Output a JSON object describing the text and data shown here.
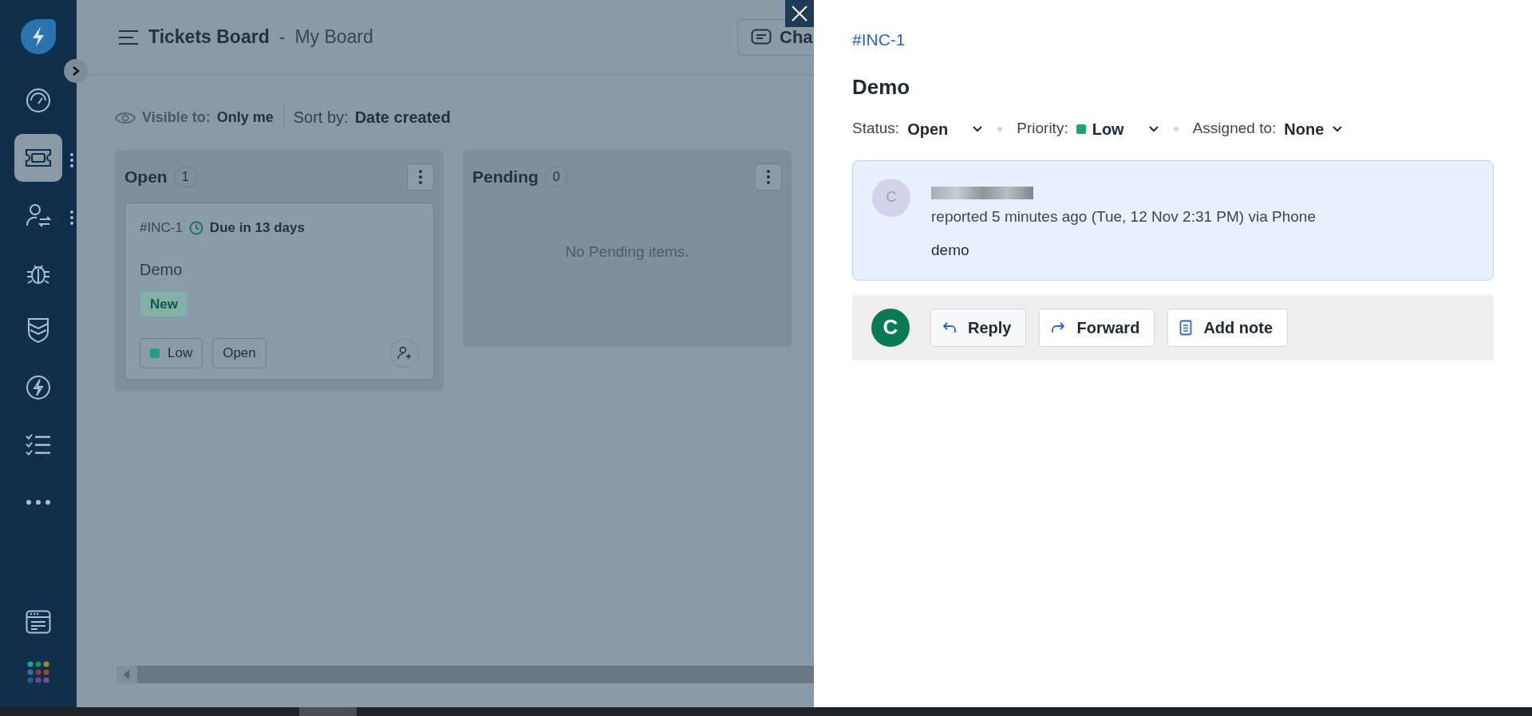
{
  "sidebar": {
    "items": [
      {
        "selected": false,
        "menu": false
      },
      {
        "selected": true,
        "menu": true
      },
      {
        "selected": false,
        "menu": true
      },
      {
        "selected": false,
        "menu": false
      },
      {
        "selected": false,
        "menu": false
      },
      {
        "selected": false,
        "menu": false
      },
      {
        "selected": false,
        "menu": false
      },
      {
        "selected": false,
        "menu": false
      }
    ]
  },
  "header": {
    "title": "Tickets Board",
    "separator": "-",
    "subtitle": "My Board",
    "chat_button": "Cha"
  },
  "filters": {
    "visible_label": "Visible to:",
    "visible_value": "Only me",
    "sort_label": "Sort by:",
    "sort_value": "Date created"
  },
  "columns": [
    {
      "title": "Open",
      "count": "1",
      "cards": [
        {
          "id": "#INC-1",
          "due": "Due in 13 days",
          "title": "Demo",
          "tag": "New",
          "priority": "Low",
          "color": "#1aa37a",
          "status": "Open"
        }
      ]
    },
    {
      "title": "Pending",
      "count": "0",
      "empty": "No Pending items."
    }
  ],
  "detail": {
    "ticket_id": "#INC-1",
    "title": "Demo",
    "fields": [
      {
        "label": "Status:",
        "value": "Open"
      },
      {
        "label": "Priority:",
        "value": "Low",
        "color": "#1aa37a"
      },
      {
        "label": "Assigned to:",
        "value": "None"
      }
    ],
    "message": {
      "avatar": "C",
      "meta": "reported 5 minutes ago (Tue, 12 Nov 2:31 PM) via Phone",
      "body": "demo"
    },
    "composer": {
      "avatar": "C",
      "buttons": [
        "Reply",
        "Forward",
        "Add note"
      ]
    }
  }
}
